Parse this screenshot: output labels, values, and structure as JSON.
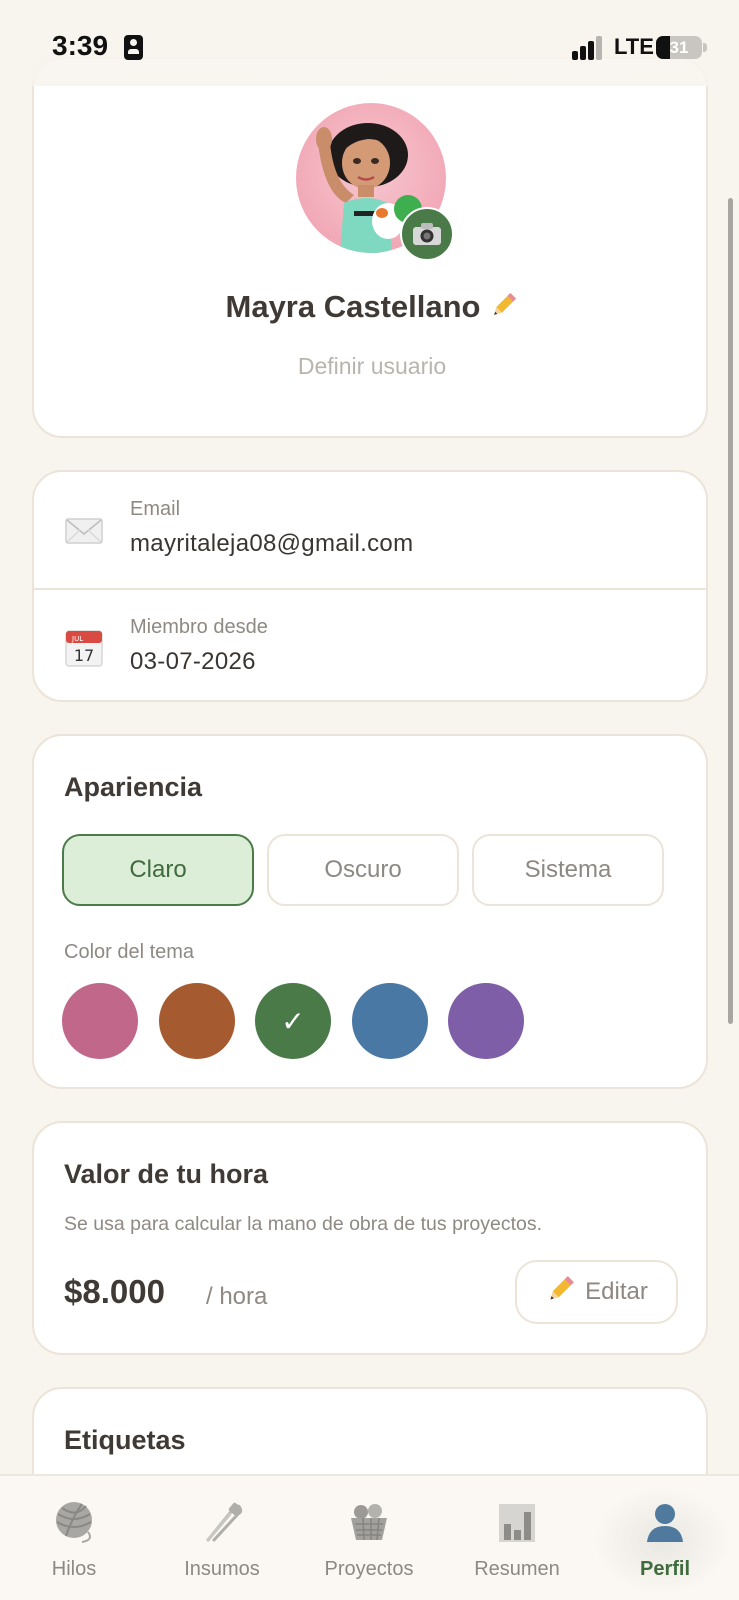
{
  "status_bar": {
    "time": "3:39",
    "network": "LTE",
    "battery": "31",
    "battery_level": 0.31
  },
  "profile": {
    "name": "Mayra Castellano",
    "username_placeholder": "Definir usuario",
    "avatar_icon": "avatar-illustration",
    "camera_icon": "camera-icon",
    "edit_icon": "pencil-icon"
  },
  "info": {
    "email_label": "Email",
    "email_value": "mayritaleja08@gmail.com",
    "email_icon": "envelope-icon",
    "member_label": "Miembro desde",
    "member_value": "03-07-2026",
    "calendar_icon": "calendar-icon",
    "calendar_month": "JUL",
    "calendar_day": "17"
  },
  "appearance": {
    "title": "Apariencia",
    "modes": [
      "Claro",
      "Oscuro",
      "Sistema"
    ],
    "selected_mode": "Claro",
    "theme_color_label": "Color del tema",
    "theme_colors": [
      "#c0678a",
      "#a55a30",
      "#4a7a48",
      "#4a78a5",
      "#7f5ea8"
    ],
    "selected_color": "#4a7a48",
    "check_mark": "✓"
  },
  "hourly_rate": {
    "title": "Valor de tu hora",
    "subtitle": "Se usa para calcular la mano de obra de tus proyectos.",
    "amount": "$8.000",
    "unit": "/ hora",
    "edit_label": "Editar"
  },
  "tags": {
    "title": "Etiquetas"
  },
  "bottom_nav": {
    "items": [
      {
        "label": "Hilos",
        "icon": "yarn-ball-icon"
      },
      {
        "label": "Insumos",
        "icon": "safety-pin-icon"
      },
      {
        "label": "Proyectos",
        "icon": "basket-icon"
      },
      {
        "label": "Resumen",
        "icon": "bar-chart-icon"
      },
      {
        "label": "Perfil",
        "icon": "person-icon"
      }
    ],
    "active": "Perfil"
  },
  "colors": {
    "accent": "#4a7a48",
    "background": "#f8f4ee",
    "card_border": "#ece4d8"
  }
}
